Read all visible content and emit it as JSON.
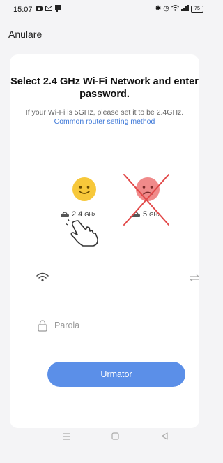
{
  "status_bar": {
    "time": "15:07",
    "battery": "75"
  },
  "header": {
    "cancel_label": "Anulare"
  },
  "card": {
    "title": "Select 2.4 GHz Wi-Fi Network and enter password.",
    "hint_text": "If your Wi-Fi is 5GHz, please set it to be 2.4GHz.",
    "hint_link": "Common router setting method",
    "band_good": {
      "main": "2.4",
      "unit": "GHz"
    },
    "band_bad": {
      "main": "5",
      "unit": "GHz"
    },
    "password_placeholder": "Parola",
    "next_label": "Urmator"
  },
  "colors": {
    "accent": "#5b8fe8",
    "link": "#3d78d8",
    "smiley_good": "#f7c83a",
    "smiley_bad": "#f08a8a",
    "cross": "#e24848"
  }
}
